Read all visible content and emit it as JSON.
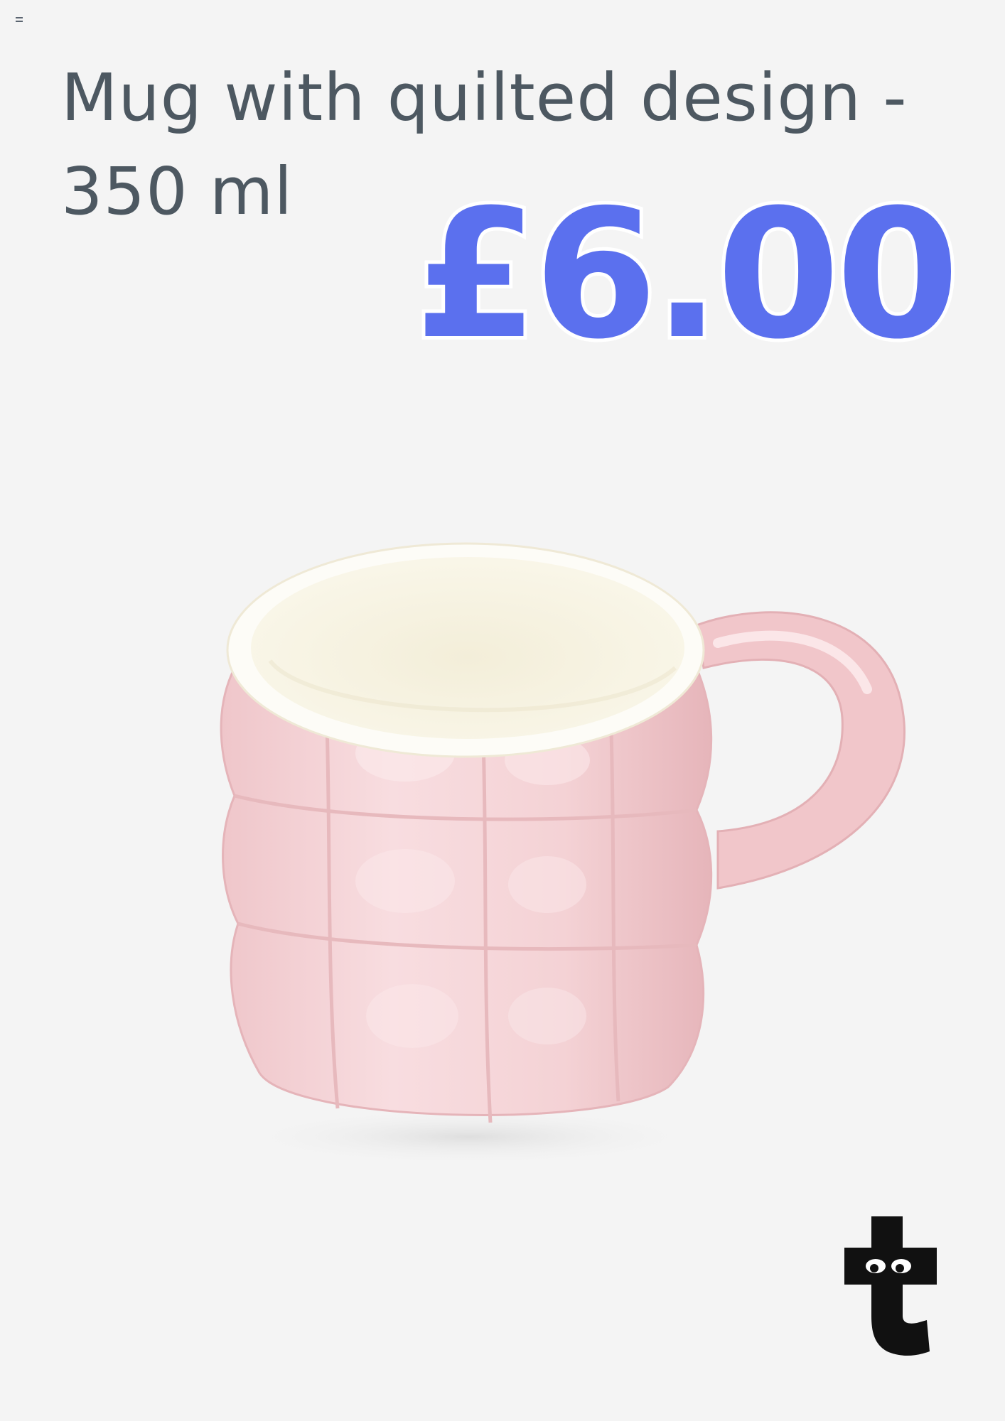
{
  "product": {
    "title_line_1": "Mug with quilted design -",
    "title_line_2": "350 ml",
    "price": "£6.00"
  },
  "colors": {
    "background": "#f4f4f4",
    "title_text": "#4d5861",
    "price": "#5b70ee",
    "mug_body": "#f3cdd0",
    "mug_interior": "#f6f2e4",
    "logo": "#111111"
  },
  "icons": {
    "menu": "menu-icon",
    "brand_logo": "brand-logo"
  }
}
